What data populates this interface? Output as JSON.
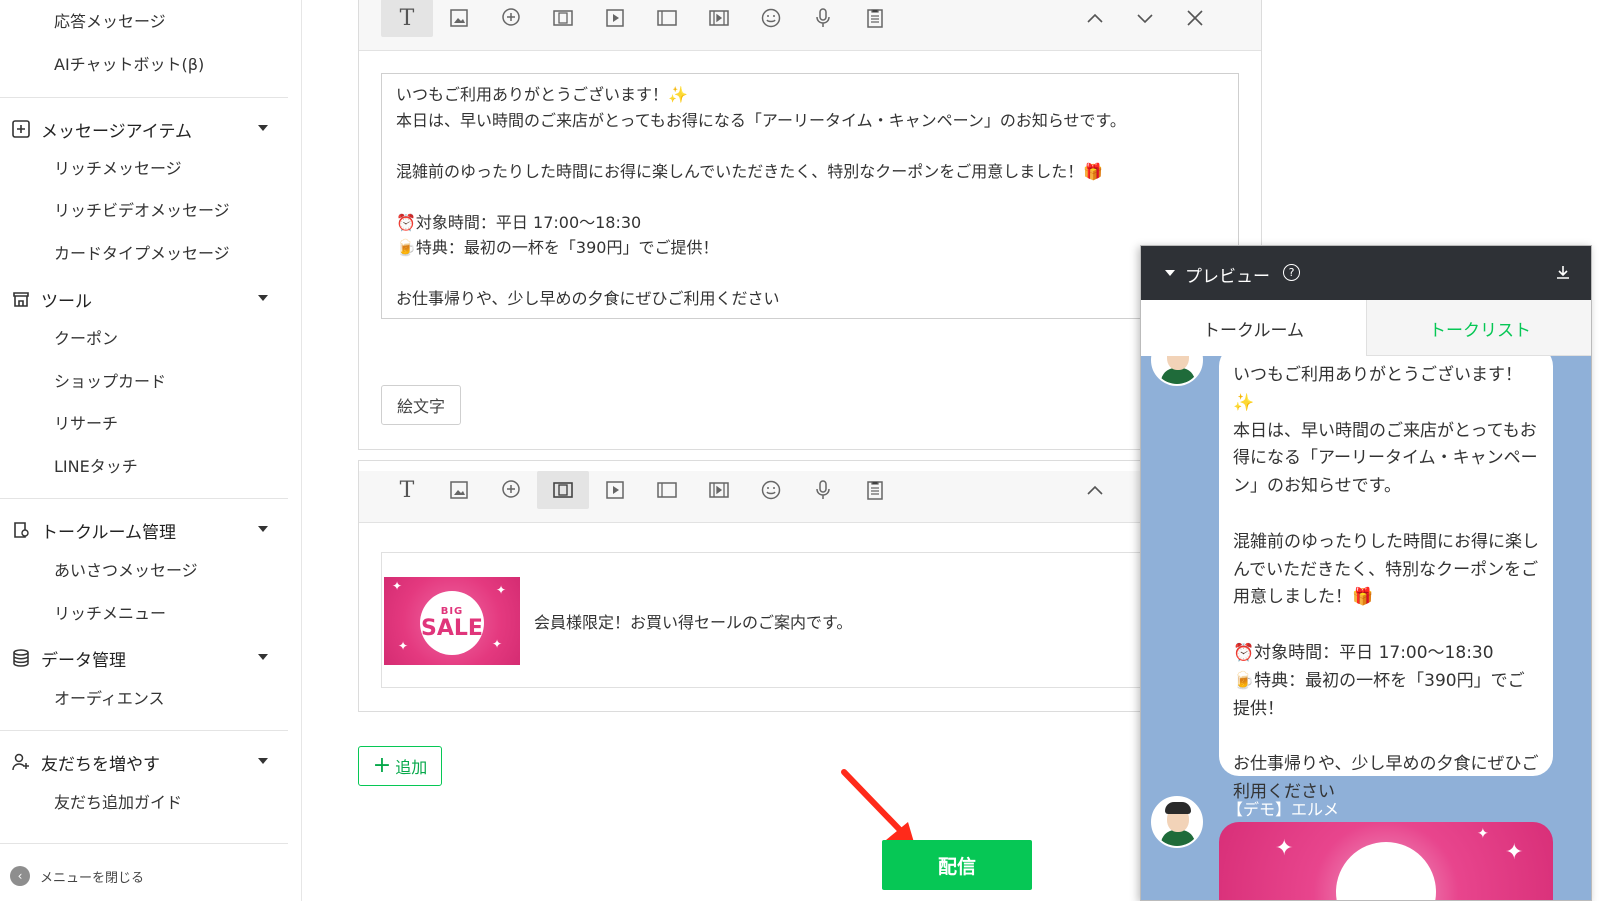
{
  "sidebar": {
    "items": [
      {
        "label": "応答メッセージ"
      },
      {
        "label": "AIチャットボット(β)"
      }
    ],
    "sections": [
      {
        "label": "メッセージアイテム",
        "children": [
          "リッチメッセージ",
          "リッチビデオメッセージ",
          "カードタイプメッセージ"
        ]
      },
      {
        "label": "ツール",
        "children": [
          "クーポン",
          "ショップカード",
          "リサーチ",
          "LINEタッチ"
        ]
      },
      {
        "label": "トークルーム管理",
        "children": [
          "あいさつメッセージ",
          "リッチメニュー"
        ]
      },
      {
        "label": "データ管理",
        "children": [
          "オーディエンス"
        ]
      },
      {
        "label": "友だちを増やす",
        "children": [
          "友だち追加ガイド"
        ]
      }
    ],
    "close_menu": "メニューを閉じる"
  },
  "editor": {
    "message_text": "いつもご利用ありがとうございます！✨\n本日は、早い時間のご来店がとってもお得になる「アーリータイム・キャンペーン」のお知らせです。\n\n混雑前のゆったりした時間にお得に楽しんでいただきたく、特別なクーポンをご用意しました！🎁\n\n⏰対象時間：平日 17:00〜18:30\n🍺特典：最初の一杯を「390円」でご提供！\n\nお仕事帰りや、少し早めの夕食にぜひご利用ください",
    "emoji_button": "絵文字",
    "card": {
      "image_big": "BIG",
      "image_sale": "SALE",
      "text": "会員様限定！お買い得セールのご案内です。"
    },
    "add_button": "追加",
    "send_button": "配信"
  },
  "preview": {
    "title": "プレビュー",
    "help": "?",
    "tabs": [
      "トークルーム",
      "トークリスト"
    ],
    "active_tab": "トークルーム",
    "bubble_text": "いつもご利用ありがとうございます！✨\n本日は、早い時間のご来店がとってもお得になる「アーリータイム・キャンペーン」のお知らせです。\n\n混雑前のゆったりした時間にお得に楽しんでいただきたく、特別なクーポンをご用意しました！🎁\n\n⏰対象時間：平日 17:00〜18:30\n🍺特典：最初の一杯を「390円」でご提供！\n\nお仕事帰りや、少し早めの夕食にぜひご利用ください",
    "sender_name": "【デモ】エルメ"
  },
  "colors": {
    "brand_green": "#06c755",
    "preview_header": "#2e3136",
    "chat_bg": "#8fb0d8",
    "arrow_red": "#ff2a1a"
  }
}
